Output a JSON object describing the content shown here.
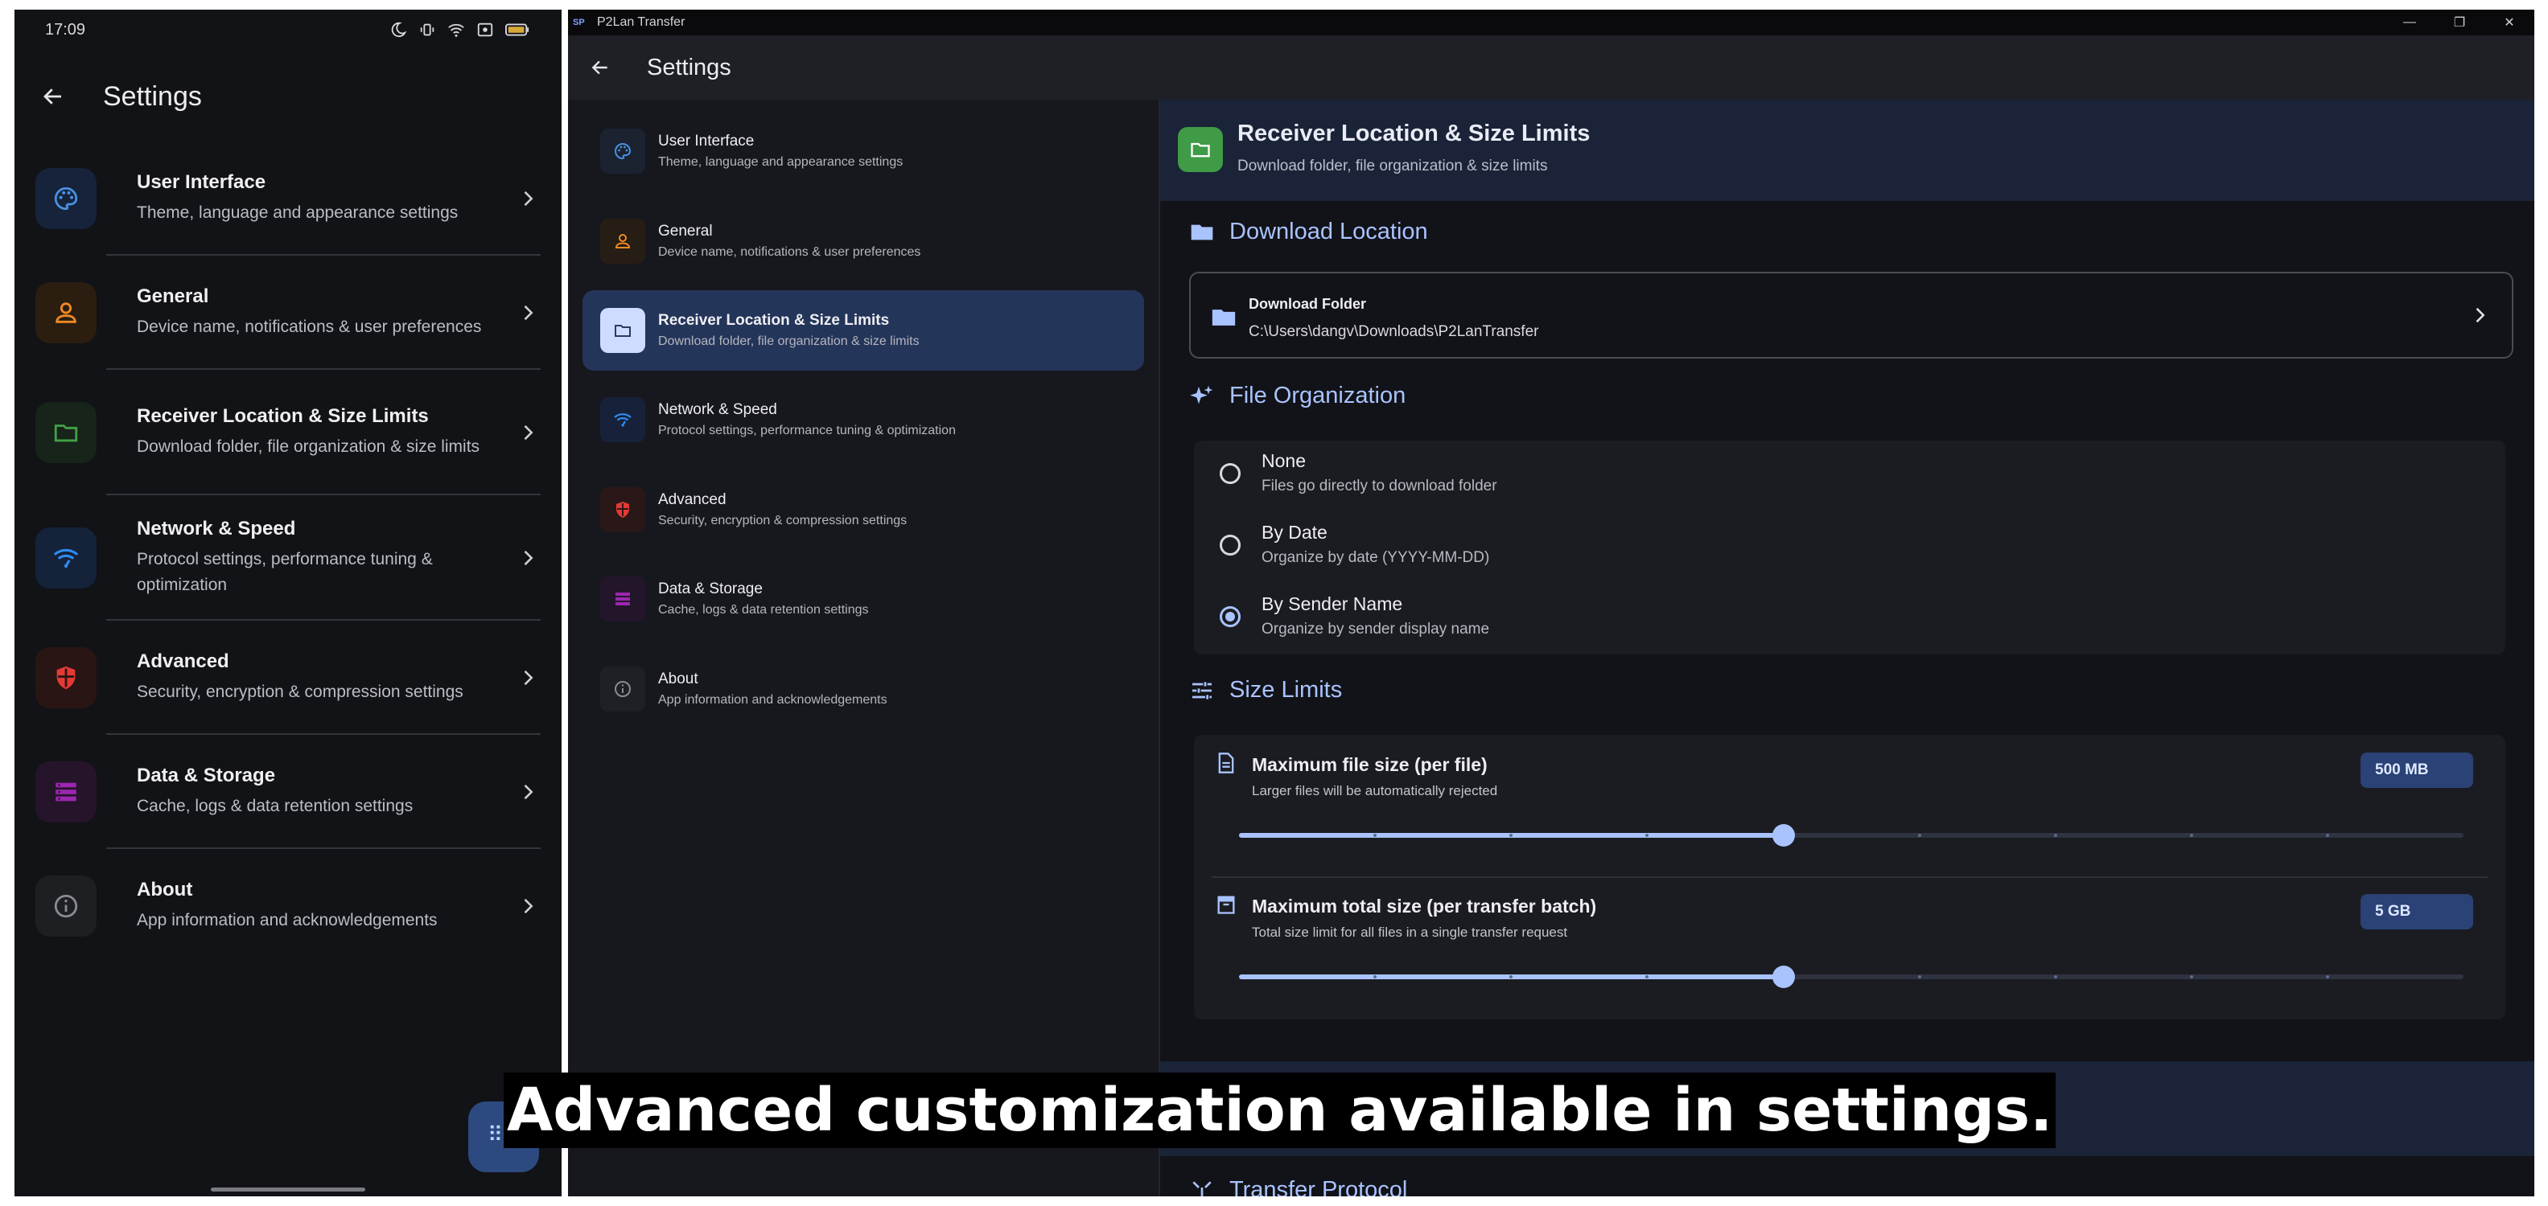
{
  "phone": {
    "status": {
      "time": "17:09"
    },
    "title": "Settings",
    "items": [
      {
        "label": "User Interface",
        "desc": "Theme, language and appearance settings",
        "icon": "palette-icon",
        "color": "#4a90e2"
      },
      {
        "label": "General",
        "desc": "Device name, notifications & user preferences",
        "icon": "person-icon",
        "color": "#f08a24"
      },
      {
        "label": "Receiver Location & Size Limits",
        "desc": "Download folder, file organization & size limits",
        "icon": "folder-icon",
        "color": "#43a047"
      },
      {
        "label": "Network & Speed",
        "desc": "Protocol settings, performance tuning & optimization",
        "icon": "wifi-icon",
        "color": "#2f8cf0"
      },
      {
        "label": "Advanced",
        "desc": "Security, encryption & compression settings",
        "icon": "shield-icon",
        "color": "#e53935"
      },
      {
        "label": "Data & Storage",
        "desc": "Cache, logs & data retention settings",
        "icon": "storage-icon",
        "color": "#9c27b0"
      },
      {
        "label": "About",
        "desc": "App information and acknowledgements",
        "icon": "info-icon",
        "color": "#8a8a90"
      }
    ]
  },
  "desktop": {
    "window_title": "P2Lan Transfer",
    "logo": "SP",
    "appbar_title": "Settings",
    "sidebar": [
      {
        "label": "User Interface",
        "desc": "Theme, language and appearance settings",
        "icon": "palette-icon"
      },
      {
        "label": "General",
        "desc": "Device name, notifications & user preferences",
        "icon": "person-icon"
      },
      {
        "label": "Receiver Location & Size Limits",
        "desc": "Download folder, file organization & size limits",
        "icon": "folder-icon",
        "active": true
      },
      {
        "label": "Network & Speed",
        "desc": "Protocol settings, performance tuning & optimization",
        "icon": "wifi-icon"
      },
      {
        "label": "Advanced",
        "desc": "Security, encryption & compression settings",
        "icon": "shield-icon"
      },
      {
        "label": "Data & Storage",
        "desc": "Cache, logs & data retention settings",
        "icon": "storage-icon"
      },
      {
        "label": "About",
        "desc": "App information and acknowledgements",
        "icon": "info-icon"
      }
    ],
    "section": {
      "title": "Receiver Location & Size Limits",
      "subtitle": "Download folder, file organization & size limits"
    },
    "download_location": {
      "heading": "Download Location",
      "label": "Download Folder",
      "path": "C:\\Users\\dangv\\Downloads\\P2LanTransfer"
    },
    "file_organization": {
      "heading": "File Organization",
      "options": [
        {
          "label": "None",
          "desc": "Files go directly to download folder",
          "selected": false
        },
        {
          "label": "By Date",
          "desc": "Organize by date (YYYY-MM-DD)",
          "selected": false
        },
        {
          "label": "By Sender Name",
          "desc": "Organize by sender display name",
          "selected": true
        }
      ]
    },
    "size_limits": {
      "heading": "Size Limits",
      "items": [
        {
          "label": "Maximum file size (per file)",
          "desc": "Larger files will be automatically rejected",
          "value": "500 MB",
          "fraction": 0.445
        },
        {
          "label": "Maximum total size (per transfer batch)",
          "desc": "Total size limit for all files in a single transfer request",
          "value": "5 GB",
          "fraction": 0.445
        }
      ]
    },
    "next_section": {
      "heading": "Transfer Protocol"
    }
  },
  "caption": "Advanced customization available in settings."
}
